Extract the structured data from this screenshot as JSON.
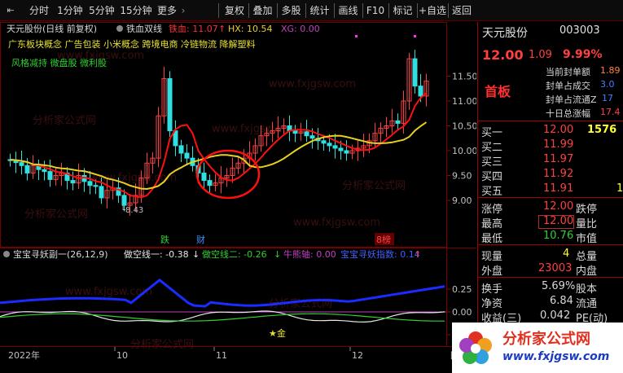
{
  "toolbar": {
    "nav_icon": "⇤",
    "items": [
      "分时",
      "1分钟",
      "5分钟",
      "15分钟",
      "更多"
    ],
    "more_arrow": "›",
    "actions": [
      "复权",
      "叠加",
      "多股",
      "统计",
      "画线",
      "F10",
      "标记",
      "+自选",
      "返回"
    ]
  },
  "chart": {
    "title": "天元股份(日线 前复权)",
    "indicator_name": "铁血双线",
    "tx_label": "铁血: 11.07",
    "tx_arrow": "↑",
    "hx_label": "HX: 10.54",
    "xg_label": "XG: 0.00",
    "concepts_line1": "广东板块概念 广告包装 小米概念 跨境电商 冷链物流 降解塑料",
    "concepts_line2": "风格减持 微盘股 微利股",
    "price_axis": [
      "11.50",
      "11.00",
      "10.50",
      "10.00",
      "9.50",
      "9.00"
    ],
    "low_marker": "8.43",
    "events": [
      {
        "label": "跌",
        "color": "#30d030"
      },
      {
        "label": "财",
        "color": "#4090ff"
      },
      {
        "label": "8榜",
        "color": "#ff4040"
      }
    ]
  },
  "sub": {
    "title": "宝宝寻妖副一(26,12,9)",
    "l1_label": "做空线一: -0.38",
    "l1_arrow": "↓",
    "l2_label": "做空线二: -0.26",
    "l2_arrow": "↓",
    "l3_label": "牛熊轴: 0.00",
    "l4_label": "宝宝寻妖指数: 0.14",
    "l4_arrow": "↑",
    "axis": [
      "0.25",
      "0.00",
      "-0.25"
    ],
    "star_label": "★金"
  },
  "time_axis": [
    "2022年",
    "10",
    "11",
    "12"
  ],
  "time_axis_end": "日",
  "quote": {
    "name": "天元股份",
    "code": "003003",
    "price": "12.00",
    "change": "1.09",
    "pct": "9.99%",
    "status": "首板",
    "stats": [
      {
        "label": "当前封单额",
        "value": "1.89"
      },
      {
        "label": "封单占成交",
        "value": "3.0"
      },
      {
        "label": "封单占流通Z",
        "value": "17"
      },
      {
        "label": "十日总涨幅",
        "value": "17.4"
      }
    ],
    "bids": [
      {
        "label": "买一",
        "price": "12.00",
        "vol": "1576"
      },
      {
        "label": "买二",
        "price": "11.99",
        "vol": ""
      },
      {
        "label": "买三",
        "price": "11.97",
        "vol": ""
      },
      {
        "label": "买四",
        "price": "11.92",
        "vol": ""
      },
      {
        "label": "买五",
        "price": "11.91",
        "vol": "1"
      }
    ],
    "details": [
      {
        "l": "涨停",
        "v": "12.00",
        "c": "#ff4040",
        "r": "跌停"
      },
      {
        "l": "最高",
        "v": "12.00",
        "c": "#ff4040",
        "r": "量比",
        "boxed": true
      },
      {
        "l": "最低",
        "v": "10.76",
        "c": "#30d030",
        "r": "市值"
      },
      {
        "l": "现量",
        "v": "4",
        "c": "#ffff30",
        "r": "总量"
      },
      {
        "l": "外盘",
        "v": "23003",
        "c": "#ff4040",
        "r": "内盘"
      }
    ],
    "fin": [
      {
        "l": "换手",
        "v": "5.69%",
        "r": "股本"
      },
      {
        "l": "净资",
        "v": "6.84",
        "r": "流通"
      },
      {
        "l": "收益(三)",
        "v": "0.042",
        "r": "PE(动)"
      }
    ]
  },
  "watermark": {
    "brand": "分析家公式网",
    "url": "www.fxjgsw.com"
  },
  "colors": {
    "up": "#ff4040",
    "down": "#30e0e0",
    "ma1": "#ff1010",
    "ma2": "#e8d020"
  }
}
